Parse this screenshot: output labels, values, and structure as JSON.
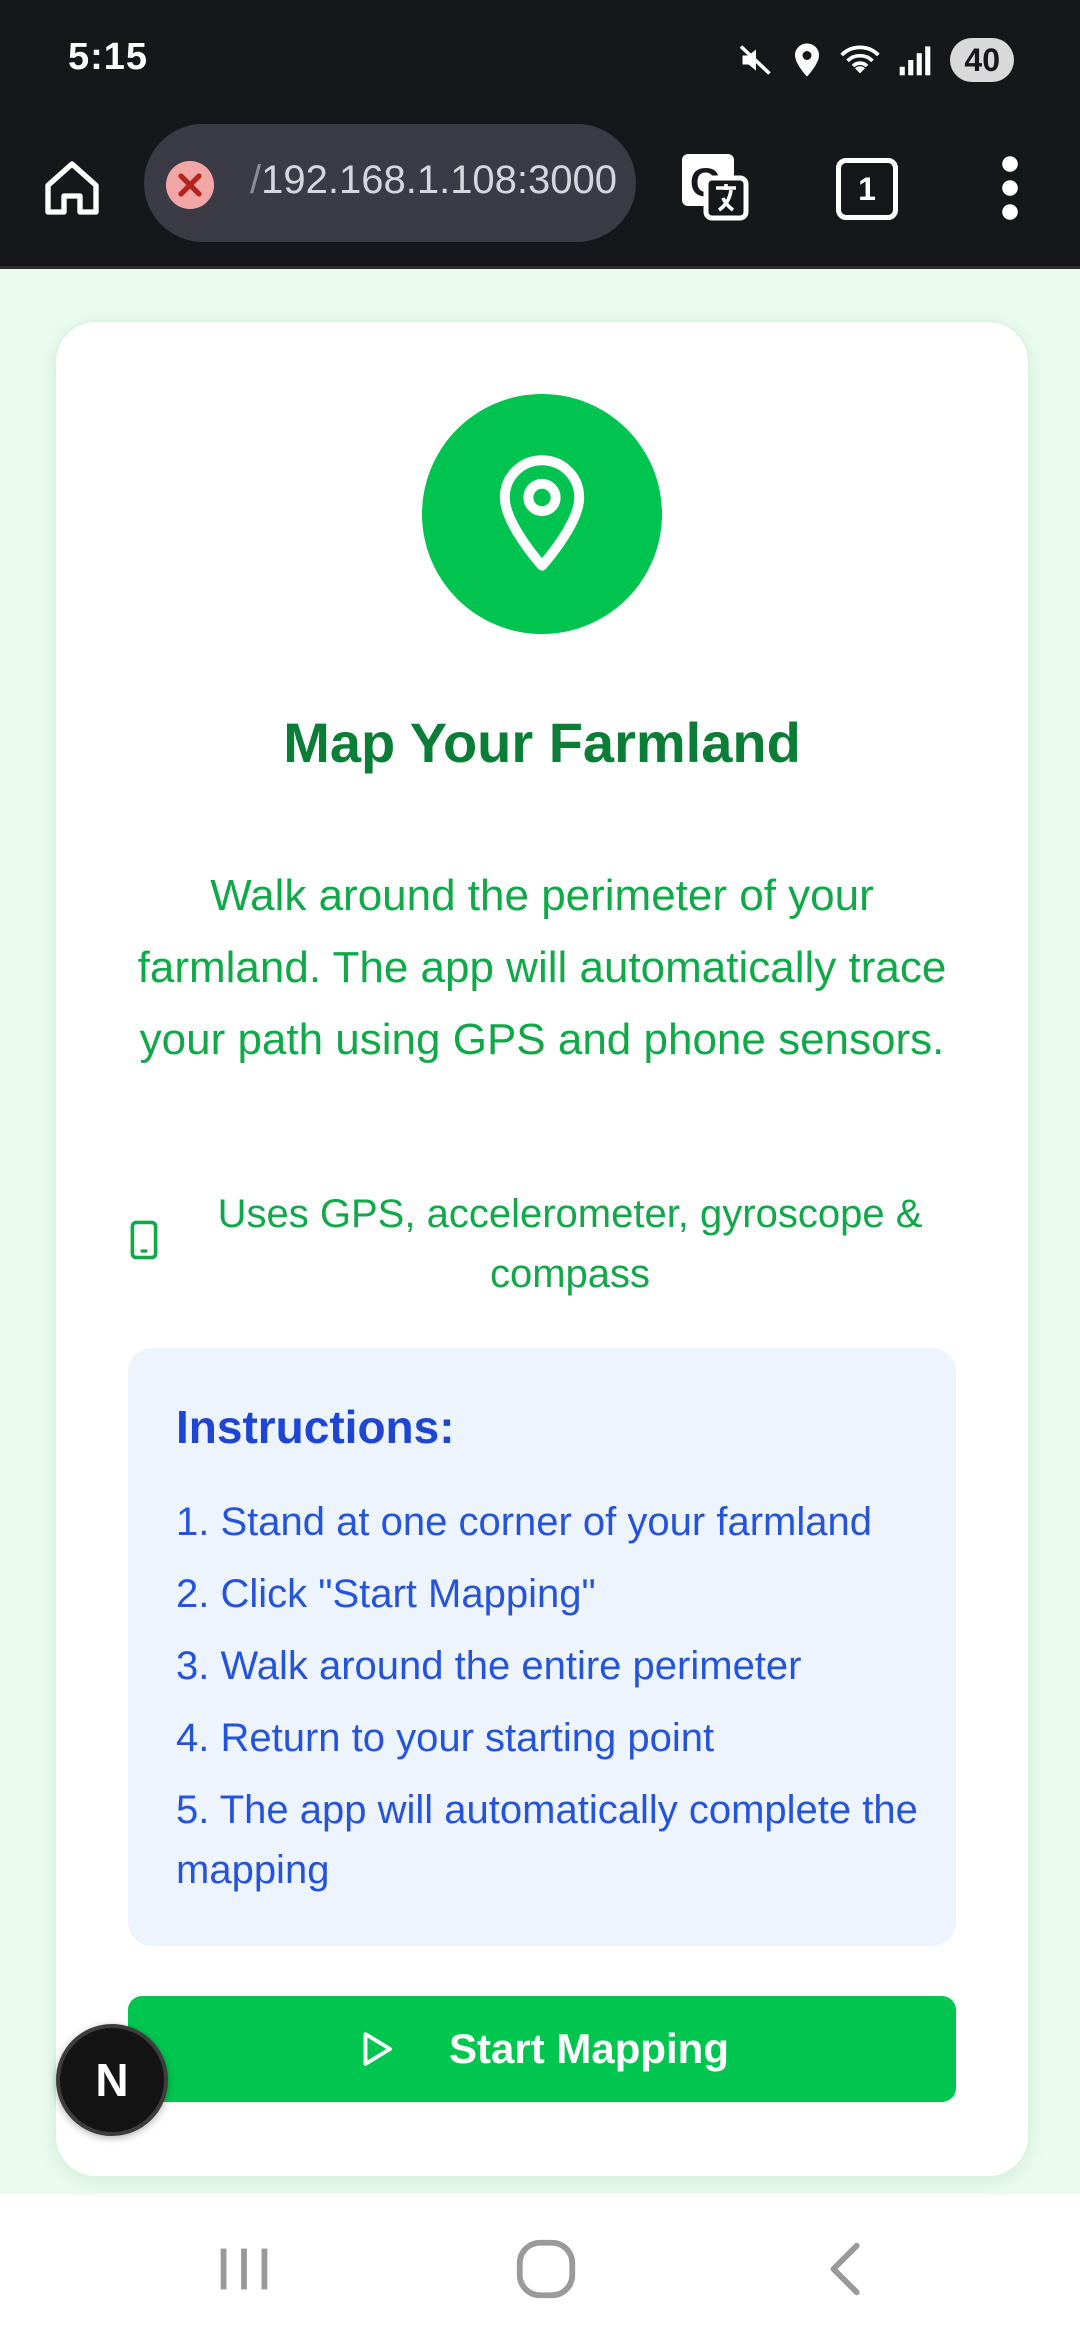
{
  "status_bar": {
    "time": "5:15",
    "battery": "40",
    "icons": [
      "mute-icon",
      "location-icon",
      "wifi-icon",
      "signal-icon"
    ]
  },
  "browser": {
    "url_prefix": "/",
    "url": "192.168.1.108:3000",
    "tab_count": "1",
    "icons": [
      "home-icon",
      "security-error-icon",
      "translate-icon",
      "more-vert-icon"
    ]
  },
  "card": {
    "icon": "map-pin-icon",
    "title": "Map Your Farmland",
    "description": "Walk around the perimeter of your farmland. The app will automatically trace your path using GPS and phone sensors.",
    "sensors_icon": "smartphone-icon",
    "sensors_note": "Uses GPS, accelerometer, gyroscope & compass",
    "instructions": {
      "title": "Instructions:",
      "steps": [
        "1. Stand at one corner of your farmland",
        "2. Click \"Start Mapping\"",
        "3. Walk around the entire perimeter",
        "4. Return to your starting point",
        "5. The app will automatically complete the mapping"
      ]
    },
    "start_button": {
      "icon": "play-icon",
      "label": "Start Mapping"
    }
  },
  "fab": {
    "label": "N"
  },
  "colors": {
    "accent_green": "#00c64f",
    "title_green": "#0a7d36",
    "text_green": "#11a84a",
    "instructions_blue": "#2453dc",
    "instructions_bg": "#eef4fe",
    "page_bg": "#ebfbf0"
  },
  "nav_bar": {
    "buttons": [
      "recent-apps-icon",
      "home-circle-icon",
      "back-icon"
    ]
  }
}
